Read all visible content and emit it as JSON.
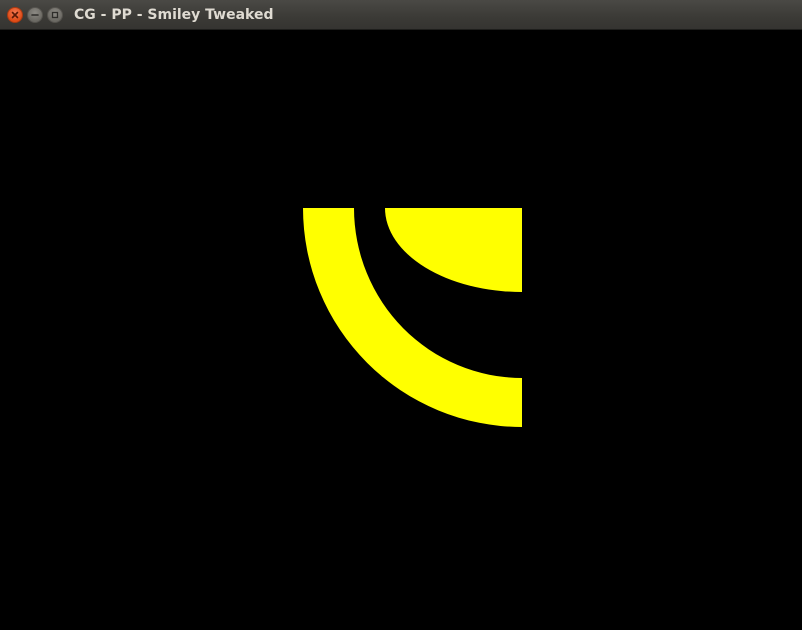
{
  "window": {
    "title": "CG - PP - Smiley Tweaked",
    "buttons": {
      "close": "close-icon",
      "minimize": "minimize-icon",
      "maximize": "maximize-icon"
    }
  },
  "canvas": {
    "background": "#000000",
    "shape_color": "#ffff00"
  }
}
